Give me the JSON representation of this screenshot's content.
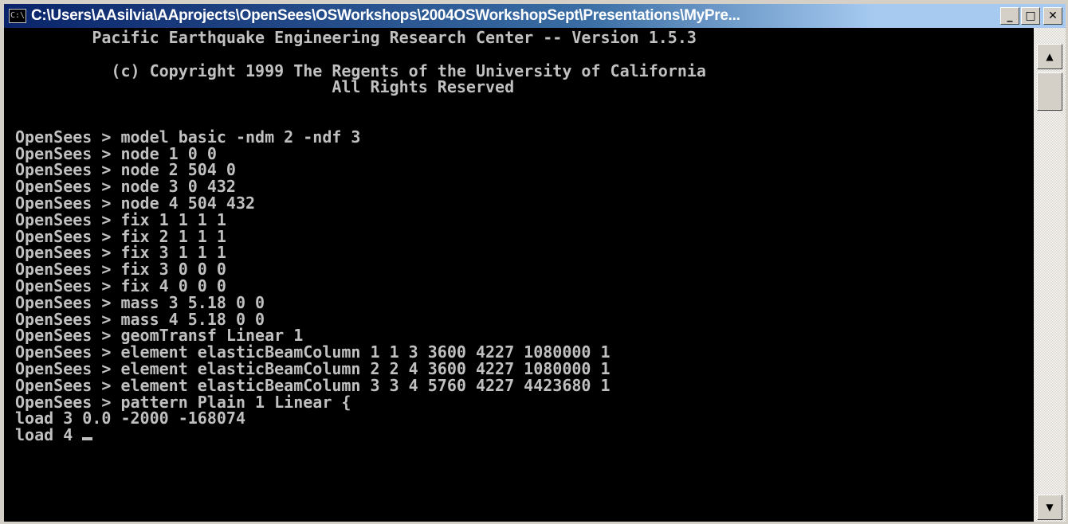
{
  "window": {
    "title": "C:\\Users\\AAsilvia\\AAprojects\\OpenSees\\OSWorkshops\\2004OSWorkshopSept\\Presentations\\MyPre...",
    "icon_label": "C:\\",
    "minimize_label": "_",
    "maximize_label": "□",
    "close_label": "✕"
  },
  "console": {
    "lines": [
      "        Pacific Earthquake Engineering Research Center -- Version 1.5.3",
      "",
      "          (c) Copyright 1999 The Regents of the University of California",
      "                                 All Rights Reserved",
      "",
      "",
      "OpenSees > model basic -ndm 2 -ndf 3",
      "OpenSees > node 1 0 0",
      "OpenSees > node 2 504 0",
      "OpenSees > node 3 0 432",
      "OpenSees > node 4 504 432",
      "OpenSees > fix 1 1 1 1",
      "OpenSees > fix 2 1 1 1",
      "OpenSees > fix 3 1 1 1",
      "OpenSees > fix 3 0 0 0",
      "OpenSees > fix 4 0 0 0",
      "OpenSees > mass 3 5.18 0 0",
      "OpenSees > mass 4 5.18 0 0",
      "OpenSees > geomTransf Linear 1",
      "OpenSees > element elasticBeamColumn 1 1 3 3600 4227 1080000 1",
      "OpenSees > element elasticBeamColumn 2 2 4 3600 4227 1080000 1",
      "OpenSees > element elasticBeamColumn 3 3 4 5760 4227 4423680 1",
      "OpenSees > pattern Plain 1 Linear {",
      "load 3 0.0 -2000 -168074"
    ],
    "current_input": "load 4 "
  },
  "scrollbar": {
    "up_arrow": "▲",
    "down_arrow": "▼"
  },
  "colors": {
    "console_bg": "#000000",
    "console_text": "#c0c0c0",
    "titlebar_start": "#0a246a",
    "titlebar_end": "#a6caf0"
  }
}
